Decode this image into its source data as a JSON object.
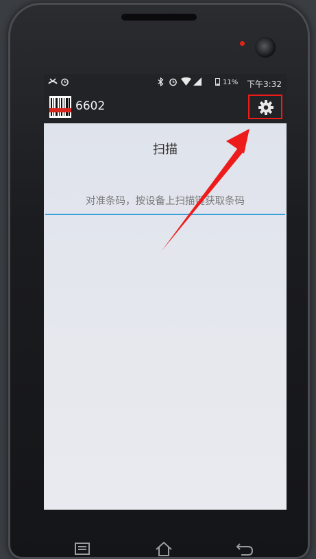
{
  "status_bar": {
    "carrier": "11%",
    "time": "下午3:32"
  },
  "action_bar": {
    "title": "6602",
    "settings_icon": "gear-icon"
  },
  "main": {
    "title": "扫描",
    "scan_field": {
      "value": "",
      "placeholder": "对准条码，按设备上扫描键获取条码"
    }
  },
  "annotation": {
    "highlight_color": "#ee1b1b"
  },
  "navigation": {
    "icons": [
      "menu-icon",
      "home-icon",
      "back-icon"
    ]
  }
}
